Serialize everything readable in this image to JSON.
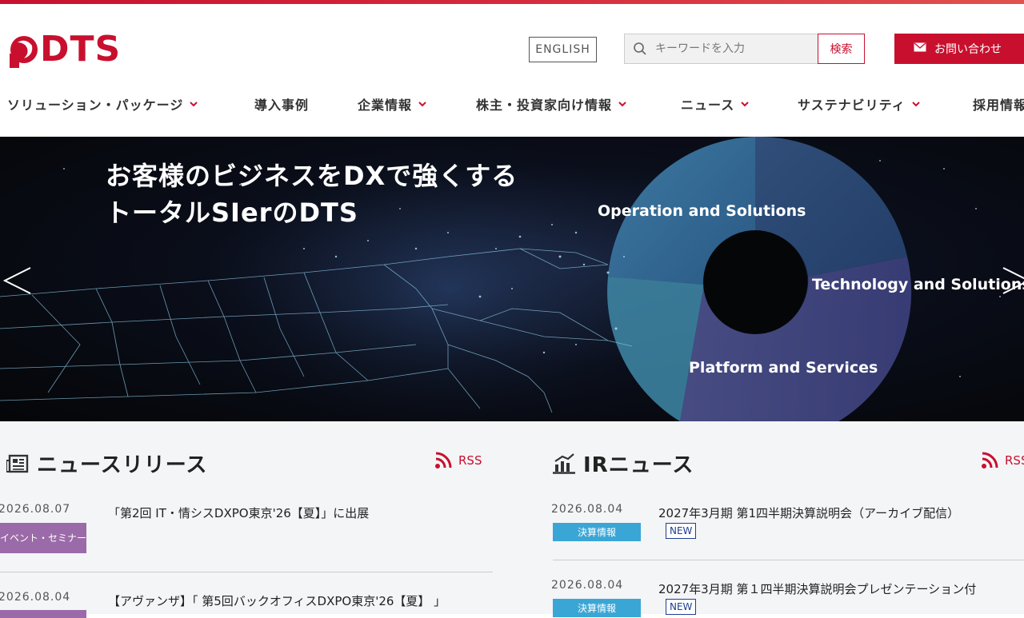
{
  "header": {
    "logo_text": "DTS",
    "english_label": "ENGLISH",
    "search_placeholder": "キーワードを入力",
    "search_button": "検索",
    "contact_label": "お問い合わせ"
  },
  "nav": [
    {
      "label": "ソリューション・パッケージ",
      "has_dropdown": true
    },
    {
      "label": "導入事例",
      "has_dropdown": false
    },
    {
      "label": "企業情報",
      "has_dropdown": true
    },
    {
      "label": "株主・投資家向け情報",
      "has_dropdown": true
    },
    {
      "label": "ニュース",
      "has_dropdown": true
    },
    {
      "label": "サステナビリティ",
      "has_dropdown": true
    },
    {
      "label": "採用情報",
      "has_dropdown": false
    }
  ],
  "hero": {
    "title_line1": "お客様のビジネスをDXで強くする",
    "title_line2": "トータルSIerのDTS",
    "label_ops": "Operation and Solutions",
    "label_tech": "Technology and Solutions",
    "label_platform": "Platform and Services"
  },
  "news_release": {
    "title": "ニュースリリース",
    "rss_label": "RSS",
    "items": [
      {
        "date": "2026.08.07",
        "category": "イベント・セミナー",
        "headline": "「第2回 IT・情シスDXPO東京'26【夏】」に出展"
      },
      {
        "date": "2026.08.04",
        "category": "",
        "headline": "【アヴァンザ】「 第5回バックオフィスDXPO東京'26【夏】 」"
      }
    ]
  },
  "ir_news": {
    "title": "IRニュース",
    "rss_label": "RSS",
    "items": [
      {
        "date": "2026.08.04",
        "category": "決算情報",
        "headline": "2027年3月期 第1四半期決算説明会（アーカイブ配信）",
        "badge": "NEW"
      },
      {
        "date": "2026.08.04",
        "category": "決算情報",
        "headline": "2027年3月期 第１四半期決算説明会プレゼンテーション付",
        "badge": "NEW"
      }
    ]
  },
  "colors": {
    "brand": "#c8102e",
    "event_category": "#9b6aa8",
    "ir_category": "#3aa6d6",
    "new_badge": "#1d3f8c"
  }
}
